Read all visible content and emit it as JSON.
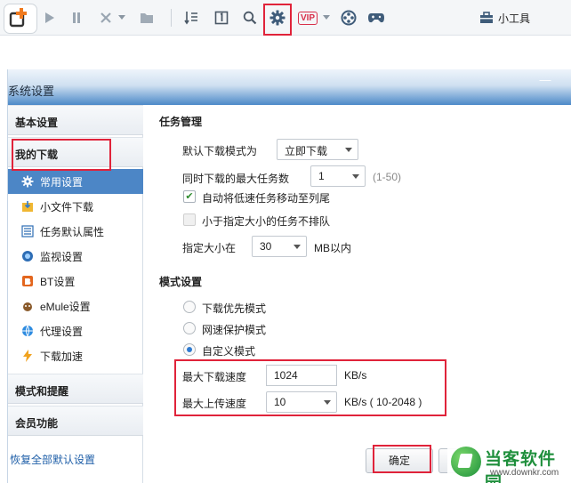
{
  "toolbar": {
    "tools_label": "小工具",
    "vip_label": "VIP"
  },
  "dialog": {
    "title": "系统设置",
    "minimize_glyph": "—"
  },
  "sidebar": {
    "sections": [
      {
        "label": "基本设置"
      },
      {
        "label": "我的下载"
      },
      {
        "label": "模式和提醒"
      },
      {
        "label": "会员功能"
      }
    ],
    "items": [
      {
        "label": "常用设置",
        "icon": "gear-icon",
        "active": true
      },
      {
        "label": "小文件下载",
        "icon": "file-icon"
      },
      {
        "label": "任务默认属性",
        "icon": "list-icon"
      },
      {
        "label": "监视设置",
        "icon": "monitor-icon"
      },
      {
        "label": "BT设置",
        "icon": "bt-icon"
      },
      {
        "label": "eMule设置",
        "icon": "emule-icon"
      },
      {
        "label": "代理设置",
        "icon": "proxy-icon"
      },
      {
        "label": "下载加速",
        "icon": "lightning-icon"
      }
    ],
    "restore_link": "恢复全部默认设置"
  },
  "task_management": {
    "title": "任务管理",
    "default_mode_label": "默认下载模式为",
    "default_mode_value": "立即下载",
    "max_tasks_label": "同时下载的最大任务数",
    "max_tasks_value": "1",
    "max_tasks_range": "(1-50)",
    "auto_move_label": "自动将低速任务移动至列尾",
    "auto_move_checked": true,
    "small_no_queue_label": "小于指定大小的任务不排队",
    "small_no_queue_checked": false,
    "size_prefix": "指定大小在",
    "size_value": "30",
    "size_unit": "MB以内"
  },
  "mode_settings": {
    "title": "模式设置",
    "options": [
      {
        "label": "下载优先模式",
        "selected": false
      },
      {
        "label": "网速保护模式",
        "selected": false
      },
      {
        "label": "自定义模式",
        "selected": true
      }
    ],
    "max_download_label": "最大下载速度",
    "max_download_value": "1024",
    "max_download_unit": "KB/s",
    "max_upload_label": "最大上传速度",
    "max_upload_value": "10",
    "max_upload_unit": "KB/s ( 10-2048 )"
  },
  "buttons": {
    "ok_label": "确定"
  },
  "watermark": {
    "name": "当客软件园",
    "url": "www.downkr.com"
  },
  "colors": {
    "highlight": "#e0233a",
    "active_item": "#4c86c6",
    "link": "#1f5fa8"
  }
}
